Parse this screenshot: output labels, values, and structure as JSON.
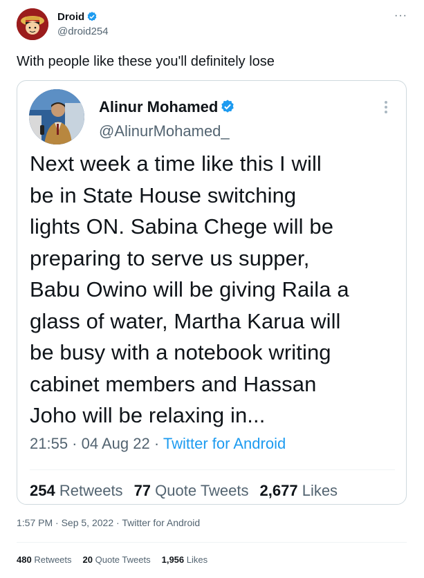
{
  "tweet": {
    "author_name": "Droid",
    "author_handle": "@droid254",
    "more": "···",
    "text": "With people like these you'll definitely lose",
    "time": "1:57 PM",
    "date": "Sep 5, 2022",
    "source": "Twitter for Android",
    "retweets": "480",
    "retweets_label": "Retweets",
    "quote_tweets": "20",
    "quote_tweets_label": "Quote Tweets",
    "likes": "1,956",
    "likes_label": "Likes"
  },
  "quoted": {
    "author_name": "Alinur Mohamed",
    "author_handle": "@AlinurMohamed_",
    "text": "Next week a time like this I will\nbe in State House switching\nlights ON. Sabina Chege will be\npreparing to serve us supper,\nBabu Owino will be giving Raila a\nglass of water, Martha Karua will\nbe busy with a notebook writing\ncabinet members and Hassan\nJoho will be relaxing in...",
    "time": "21:55",
    "date": "04 Aug 22",
    "source": "Twitter for Android",
    "retweets": "254",
    "retweets_label": "Retweets",
    "quote_tweets": "77",
    "quote_tweets_label": "Quote Tweets",
    "likes": "2,677",
    "likes_label": "Likes"
  },
  "colors": {
    "verified": "#1d9bf0",
    "link": "#1d9bf0",
    "muted": "#536471",
    "border": "#cfd9de"
  }
}
